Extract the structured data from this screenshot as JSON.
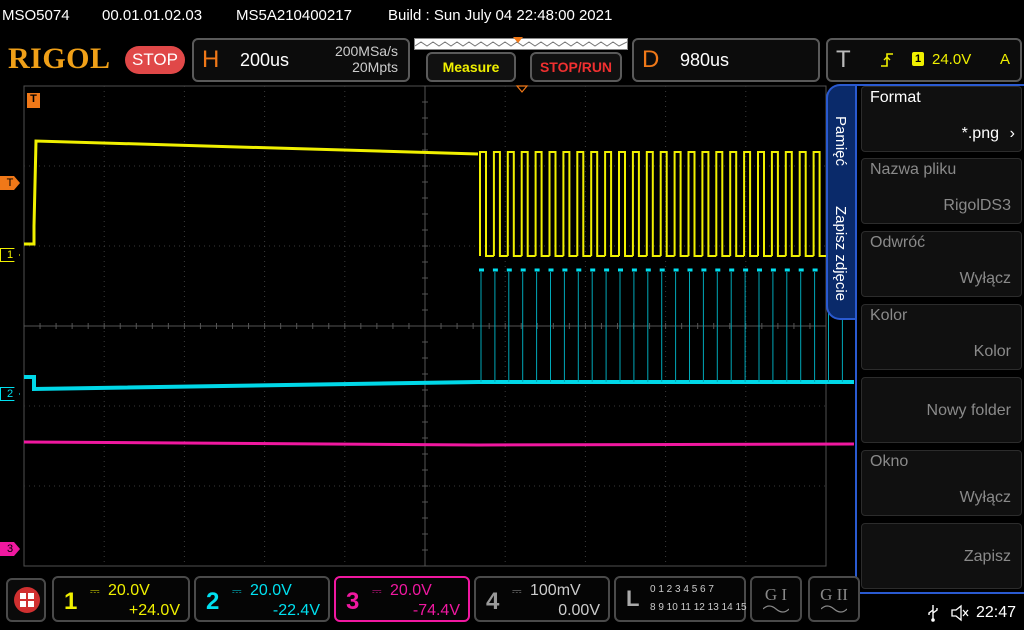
{
  "titlebar": {
    "model": "MSO5074",
    "firmware": "00.01.01.02.03",
    "serial": "MS5A210400217",
    "build": "Build : Sun July 04 22:48:00 2021"
  },
  "header": {
    "logo": "RIGOL",
    "run_state": "STOP",
    "horizontal": {
      "letter": "H",
      "timebase": "200us",
      "sample_rate": "200MSa/s",
      "memory_depth": "20Mpts"
    },
    "measure_label": "Measure",
    "stop_run_label": "STOP/RUN",
    "delay": {
      "letter": "D",
      "value": "980us"
    },
    "trigger": {
      "letter": "T",
      "source": "1",
      "level": "24.0V",
      "mode": "A"
    }
  },
  "markers": {
    "trigger": "T",
    "ch1": "1",
    "ch2": "2",
    "ch3": "3"
  },
  "side_tabs": [
    "Pamięć",
    "Zapisz zdjęcie"
  ],
  "menu": [
    {
      "label": "Format",
      "value": "*.png"
    },
    {
      "label": "Nazwa pliku",
      "value": "RigolDS3"
    },
    {
      "label": "Odwróć",
      "value": "Wyłącz"
    },
    {
      "label": "Kolor",
      "value": "Kolor"
    },
    {
      "label": "",
      "value": "Nowy folder"
    },
    {
      "label": "Okno",
      "value": "Wyłącz"
    },
    {
      "label": "",
      "value": "Zapisz"
    }
  ],
  "channels": [
    {
      "num": "1",
      "scale": "20.0V",
      "offset": "+24.0V",
      "color": "#f0f000"
    },
    {
      "num": "2",
      "scale": "20.0V",
      "offset": "-22.4V",
      "color": "#00e0f0"
    },
    {
      "num": "3",
      "scale": "20.0V",
      "offset": "-74.4V",
      "color": "#f018a0"
    },
    {
      "num": "4",
      "scale": "100mV",
      "offset": "0.00V",
      "color": "#9a9a9a"
    }
  ],
  "logic": {
    "letter": "L",
    "row1": "0 1 2 3  4 5 6 7",
    "row2": "8 9 10 11 12 13 14 15"
  },
  "g1_label": "G I",
  "g2_label": "G II",
  "status": {
    "time": "22:47"
  },
  "colors": {
    "ch1": "#f0f000",
    "ch2": "#00e0f0",
    "ch3": "#f018a0",
    "accent": "#f07818",
    "menu_border": "#2a5ad0"
  }
}
